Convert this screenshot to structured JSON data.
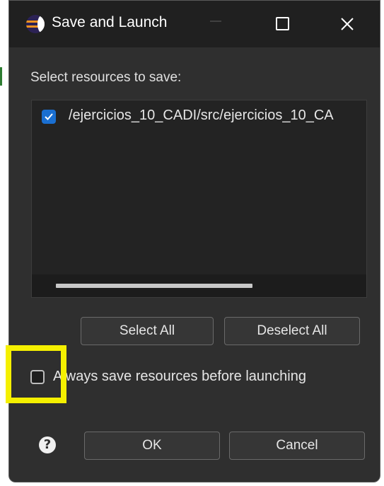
{
  "window": {
    "title": "Save and Launch"
  },
  "prompt": "Select resources to save:",
  "resources": [
    {
      "path": "/ejercicios_10_CADI/src/ejercicios_10_CA",
      "checked": true
    }
  ],
  "buttons": {
    "select_all": "Select All",
    "deselect_all": "Deselect All",
    "ok": "OK",
    "cancel": "Cancel"
  },
  "always_save": {
    "label": "Always save resources before launching",
    "checked": false
  },
  "colors": {
    "checkbox_accent": "#1a6fd1",
    "highlight": "#f5f000"
  },
  "icons": {
    "app": "eclipse-icon",
    "help": "help-icon",
    "minimize": "minimize-icon",
    "maximize": "maximize-icon",
    "close": "close-icon"
  }
}
